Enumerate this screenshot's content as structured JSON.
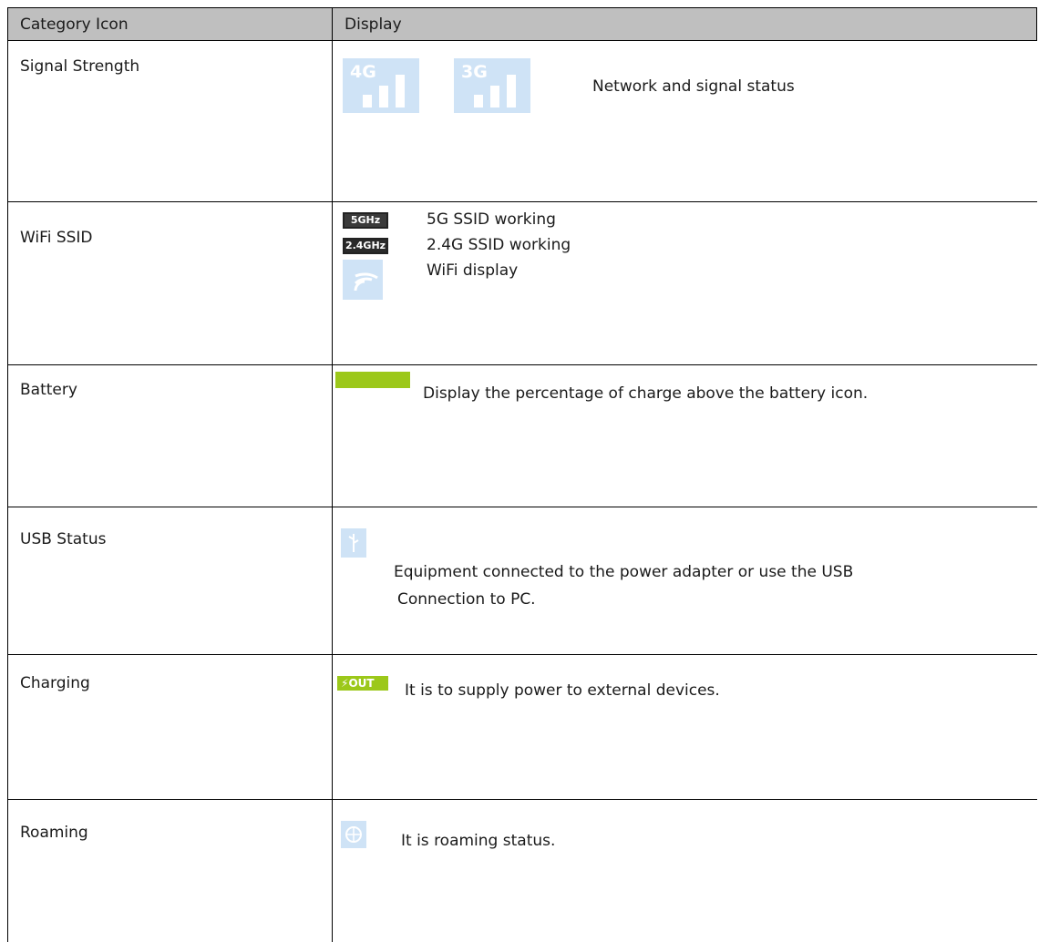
{
  "header": {
    "col1": "Category Icon",
    "col2": "Display"
  },
  "rows": [
    {
      "category": "Signal Strength",
      "icons": [
        "signal-4g-icon",
        "signal-3g-icon"
      ],
      "icon_labels": [
        "4G",
        "3G"
      ],
      "lines": [
        "Network and  signal status"
      ]
    },
    {
      "category": "WiFi SSID",
      "badges": [
        "5GHz",
        "2.4GHz"
      ],
      "lines": [
        "5G SSID working",
        "2.4G SSID working",
        "WiFi display"
      ]
    },
    {
      "category": "Battery",
      "lines": [
        "Display the percentage of charge above the battery icon."
      ]
    },
    {
      "category": "USB Status",
      "lines": [
        "Equipment connected to the power adapter or use the USB",
        "Connection to PC."
      ]
    },
    {
      "category": "Charging",
      "icon_label": "OUT",
      "lines": [
        "It is to supply power to external devices."
      ]
    },
    {
      "category": "Roaming",
      "lines": [
        "It is roaming status."
      ]
    }
  ],
  "colors": {
    "header_bg": "#bfbfbf",
    "icon_blue": "#cfe3f6",
    "icon_green": "#9cc81a"
  }
}
